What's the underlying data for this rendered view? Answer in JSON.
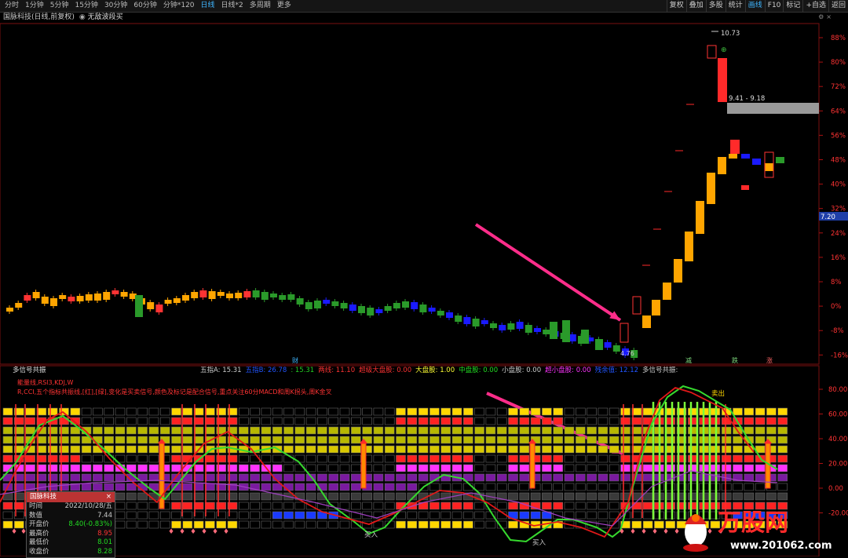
{
  "toolbar": {
    "left_items": [
      "分时",
      "1分钟",
      "5分钟",
      "15分钟",
      "30分钟",
      "60分钟",
      "分钟*120",
      "日线",
      "日线*2",
      "多周期",
      "更多"
    ],
    "active_left": "日线",
    "right_items": [
      "复权",
      "叠加",
      "多股",
      "统计",
      "画线",
      "F10",
      "标记",
      "+自选",
      "返回"
    ],
    "active_right": "画线"
  },
  "chart_title": "国脉科技(日线,前复权)",
  "indicator_toggle": "无敌波段买",
  "price_axis": {
    "labels": [
      "88%",
      "80%",
      "72%",
      "64%",
      "56%",
      "48%",
      "40%",
      "32%",
      "24%",
      "16%",
      "8%",
      "0%",
      "-8%",
      "-16%"
    ],
    "current_price_badge": "7.20",
    "badge_color": "#1f3fa8"
  },
  "annotations": {
    "high_price": "10.73",
    "range_label": "9.41 - 9.18",
    "low_price": "4.76",
    "event_marks": [
      "财",
      "减",
      "跌",
      "涨"
    ]
  },
  "sub_header": {
    "name": "多信号共振",
    "items": [
      {
        "text": "五指A: 15.31",
        "color": "#cccccc"
      },
      {
        "text": "五指B: 26.78",
        "color": "#2255ff"
      },
      {
        "text": ": 15.31",
        "color": "#22cc22"
      },
      {
        "text": "两线: 11.10",
        "color": "#ff3333"
      },
      {
        "text": "超级大盘股: 0.00",
        "color": "#ff3333"
      },
      {
        "text": "大盘股: 1.00",
        "color": "#ffff33"
      },
      {
        "text": "中盘股: 0.00",
        "color": "#22dd22"
      },
      {
        "text": "小盘股: 0.00",
        "color": "#cccccc"
      },
      {
        "text": "超小盘股: 0.00",
        "color": "#ff33ff"
      },
      {
        "text": "残余值: 12.12",
        "color": "#2255ff"
      },
      {
        "text": "多信号共振:",
        "color": "#cccccc"
      }
    ]
  },
  "indicator_desc": {
    "line1": "能量线,RSI3,KDJ,W",
    "line2": "R,CCI,五个指标共振线,[红],[绿],变化是买卖信号,颜色及标记是配合信号,重点关注60分MACD和周K拐头,周K金叉"
  },
  "osc_axis": {
    "labels": [
      "80.00",
      "60.00",
      "40.00",
      "20.00",
      "0.00",
      "-20.00"
    ]
  },
  "osc_labels": {
    "sell": "卖出",
    "buy1": "买入",
    "buy2": "买入"
  },
  "popup": {
    "title": "国脉科技",
    "close": "×",
    "rows": [
      {
        "label": "时间",
        "value": "2022/10/28/五",
        "color": "#cccccc"
      },
      {
        "label": "数值",
        "value": "7.44",
        "color": "#cccccc"
      },
      {
        "label": "开盘价",
        "value": "8.40(-0.83%)",
        "color": "#22dd22"
      },
      {
        "label": "最高价",
        "value": "8.95",
        "color": "#ff3333"
      },
      {
        "label": "最低价",
        "value": "8.01",
        "color": "#22dd22"
      },
      {
        "label": "收盘价",
        "value": "8.28",
        "color": "#22dd22"
      }
    ]
  },
  "watermark": {
    "brand": "万股网",
    "url": "www.201062.com"
  }
}
